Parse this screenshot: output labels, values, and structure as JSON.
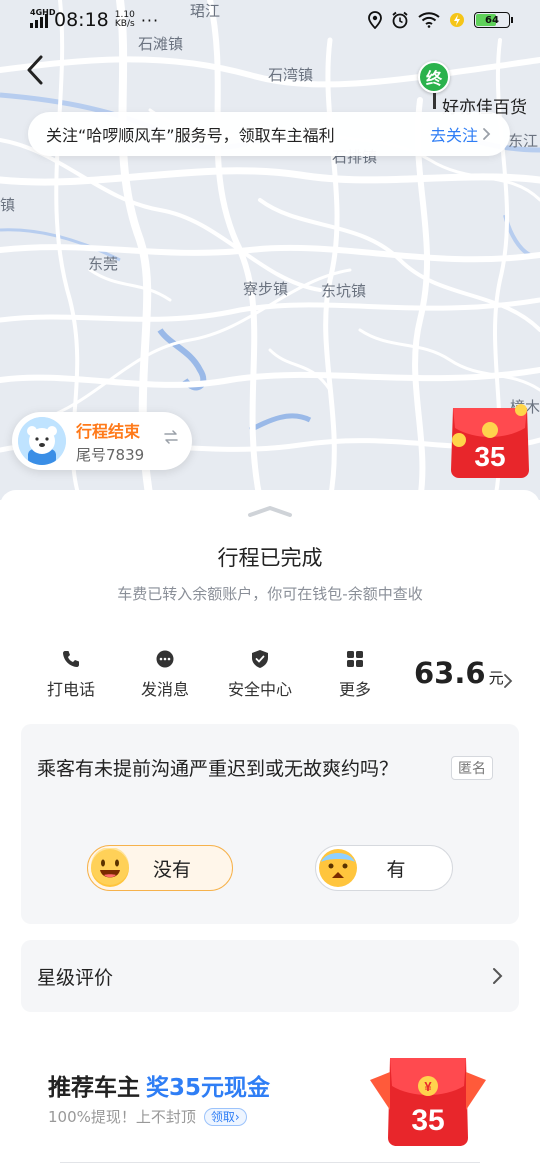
{
  "status_bar": {
    "network": "4GHD",
    "time": "08:18",
    "speed_value": "1.10",
    "speed_unit": "KB/s",
    "more": "···",
    "battery": "64"
  },
  "map": {
    "labels": [
      "珺江",
      "石滩镇",
      "石湾镇",
      "石排镇",
      "东江",
      "镇",
      "东莞",
      "寮步镇",
      "东坑镇",
      "樟木"
    ],
    "end_marker": "终",
    "end_place": "好亦佳百货"
  },
  "follow_banner": {
    "text": "关注“哈啰顺风车”服务号，领取车主福利",
    "link": "去关注"
  },
  "trip_chip": {
    "title": "行程结束",
    "subtitle": "尾号7839"
  },
  "red_packet": {
    "amount": "35"
  },
  "sheet": {
    "title": "行程已完成",
    "subtitle": "车费已转入余额账户，你可在钱包-余额中查收"
  },
  "actions": [
    {
      "label": "打电话",
      "icon": "phone-icon"
    },
    {
      "label": "发消息",
      "icon": "message-icon"
    },
    {
      "label": "安全中心",
      "icon": "shield-icon"
    },
    {
      "label": "更多",
      "icon": "grid-icon"
    }
  ],
  "fare": {
    "amount": "63.6",
    "unit": "元"
  },
  "question": {
    "text": "乘客有未提前沟通严重迟到或无故爽约吗？",
    "anon": "匿名",
    "options": [
      {
        "label": "没有",
        "selected": true
      },
      {
        "label": "有",
        "selected": false
      }
    ]
  },
  "rating": {
    "label": "星级评价"
  },
  "promo": {
    "title": "推荐车主",
    "highlight": "奖35元现金",
    "subtitle": "100%提现！上不封顶",
    "button": "领取",
    "packet_symbol": "¥",
    "packet_amount": "35"
  },
  "colors": {
    "accent": "#2f7ef5",
    "orange": "#ff7a1a",
    "green": "#2bb24c",
    "red_packet": "#e8262b"
  }
}
